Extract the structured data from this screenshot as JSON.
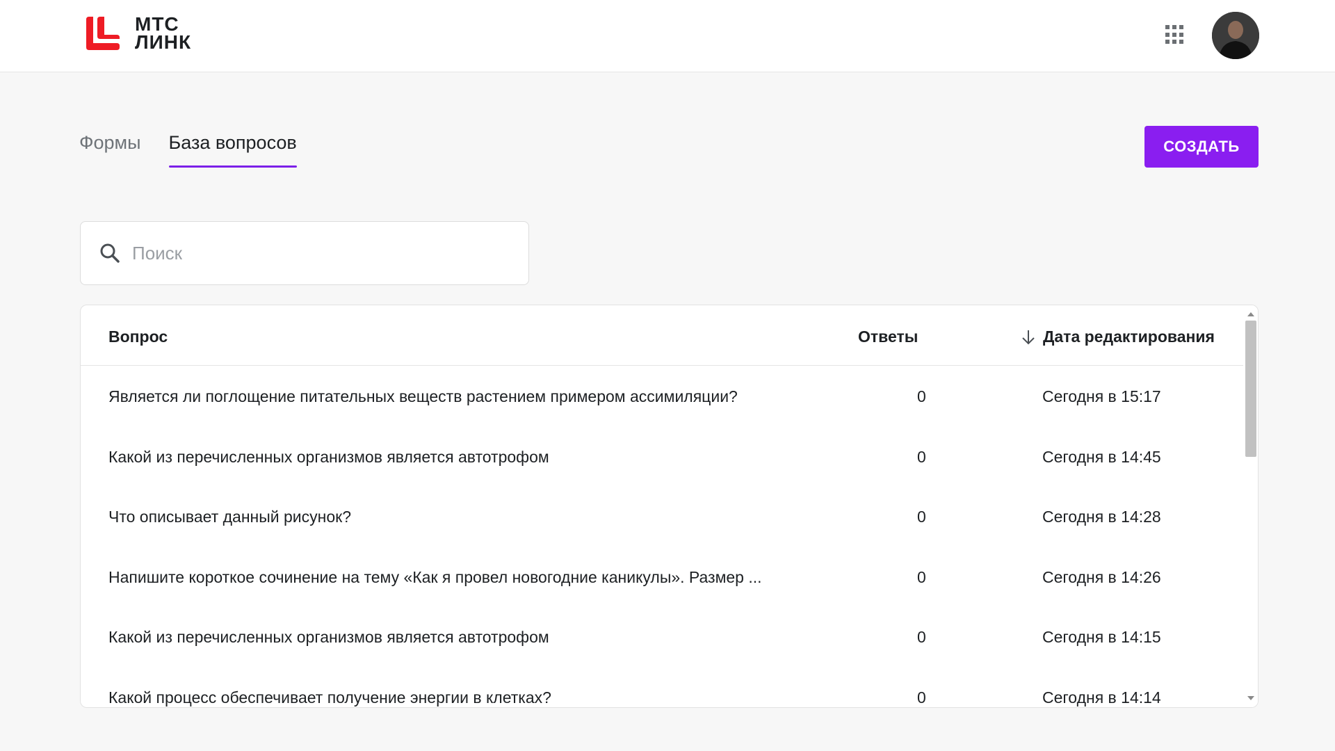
{
  "header": {
    "logo_line1": "МТС",
    "logo_line2": "ЛИНК",
    "brand_color": "#ee1c25",
    "apps_icon": "grid-icon",
    "avatar": "user-avatar"
  },
  "tabs": [
    {
      "label": "Формы",
      "active": false
    },
    {
      "label": "База вопросов",
      "active": true
    }
  ],
  "accent_color": "#8a1ef0",
  "create_button": {
    "label": "СОЗДАТЬ"
  },
  "search": {
    "placeholder": "Поиск",
    "value": ""
  },
  "table": {
    "columns": {
      "question": "Вопрос",
      "answers": "Ответы",
      "date": "Дата редактирования",
      "date_sort": "descending"
    },
    "rows": [
      {
        "question": "Является ли поглощение питательных веществ растением примером ассимиляции?",
        "answers": "0",
        "date": "Сегодня в 15:17"
      },
      {
        "question": "Какой из перечисленных организмов является автотрофом",
        "answers": "0",
        "date": "Сегодня в 14:45"
      },
      {
        "question": "Что описывает данный рисунок?",
        "answers": "0",
        "date": "Сегодня в 14:28"
      },
      {
        "question": "Напишите короткое сочинение на тему «Как я провел новогодние каникулы». Размер ...",
        "answers": "0",
        "date": "Сегодня в 14:26"
      },
      {
        "question": "Какой из перечисленных организмов является автотрофом",
        "answers": "0",
        "date": "Сегодня в 14:15"
      },
      {
        "question": "Какой процесс обеспечивает получение энергии в клетках?",
        "answers": "0",
        "date": "Сегодня в 14:14"
      }
    ]
  }
}
